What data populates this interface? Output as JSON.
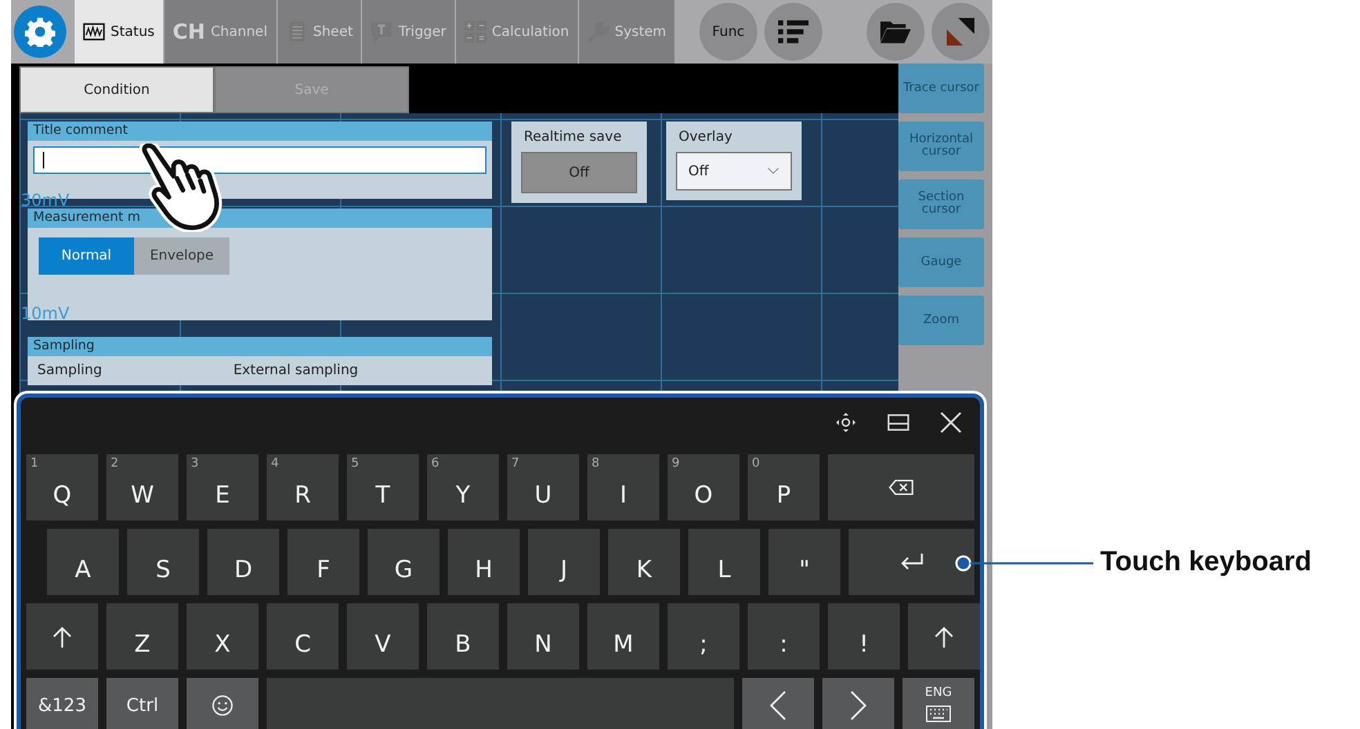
{
  "toolbar": {
    "tabs": [
      {
        "label": "Status",
        "selected": true
      },
      {
        "label": "Channel",
        "icon_text": "CH",
        "selected": false
      },
      {
        "label": "Sheet",
        "selected": false
      },
      {
        "label": "Trigger",
        "selected": false
      },
      {
        "label": "Calculation",
        "selected": false
      },
      {
        "label": "System",
        "selected": false
      }
    ],
    "func_button": "Func"
  },
  "sub_tabs": [
    {
      "label": "Condition",
      "selected": true
    },
    {
      "label": "Save",
      "selected": false
    }
  ],
  "axis_labels": [
    "30mV",
    "10mV"
  ],
  "title_comment": {
    "header": "Title comment"
  },
  "measurement_mode": {
    "header": "Measurement m",
    "options": [
      {
        "label": "Normal",
        "selected": true
      },
      {
        "label": "Envelope",
        "selected": false
      }
    ]
  },
  "sampling": {
    "header": "Sampling",
    "label": "Sampling",
    "value": "External sampling"
  },
  "realtime_save": {
    "header": "Realtime save",
    "value": "Off"
  },
  "overlay": {
    "header": "Overlay",
    "value": "Off"
  },
  "side_buttons": [
    "Trace cursor",
    "Horizontal cursor",
    "Section cursor",
    "Gauge",
    "Zoom"
  ],
  "keyboard": {
    "rows": [
      [
        {
          "kind": "char",
          "label": "Q",
          "hint": "1"
        },
        {
          "kind": "char",
          "label": "W",
          "hint": "2"
        },
        {
          "kind": "char",
          "label": "E",
          "hint": "3"
        },
        {
          "kind": "char",
          "label": "R",
          "hint": "4"
        },
        {
          "kind": "char",
          "label": "T",
          "hint": "5"
        },
        {
          "kind": "char",
          "label": "Y",
          "hint": "6"
        },
        {
          "kind": "char",
          "label": "U",
          "hint": "7"
        },
        {
          "kind": "char",
          "label": "I",
          "hint": "8"
        },
        {
          "kind": "char",
          "label": "O",
          "hint": "9"
        },
        {
          "kind": "char",
          "label": "P",
          "hint": "0"
        },
        {
          "kind": "backspace"
        }
      ],
      [
        {
          "kind": "char",
          "label": "A"
        },
        {
          "kind": "char",
          "label": "S"
        },
        {
          "kind": "char",
          "label": "D"
        },
        {
          "kind": "char",
          "label": "F"
        },
        {
          "kind": "char",
          "label": "G"
        },
        {
          "kind": "char",
          "label": "H"
        },
        {
          "kind": "char",
          "label": "J"
        },
        {
          "kind": "char",
          "label": "K"
        },
        {
          "kind": "char",
          "label": "L"
        },
        {
          "kind": "char",
          "label": "\""
        },
        {
          "kind": "enter"
        }
      ],
      [
        {
          "kind": "shift"
        },
        {
          "kind": "char",
          "label": "Z"
        },
        {
          "kind": "char",
          "label": "X"
        },
        {
          "kind": "char",
          "label": "C"
        },
        {
          "kind": "char",
          "label": "V"
        },
        {
          "kind": "char",
          "label": "B"
        },
        {
          "kind": "char",
          "label": "N"
        },
        {
          "kind": "char",
          "label": "M"
        },
        {
          "kind": "char",
          "label": ";"
        },
        {
          "kind": "char",
          "label": ":"
        },
        {
          "kind": "char",
          "label": "!"
        },
        {
          "kind": "shift"
        }
      ],
      [
        {
          "kind": "func",
          "label": "&123"
        },
        {
          "kind": "func",
          "label": "Ctrl"
        },
        {
          "kind": "emoji"
        },
        {
          "kind": "space"
        },
        {
          "kind": "left"
        },
        {
          "kind": "right"
        },
        {
          "kind": "lang",
          "label": "ENG"
        }
      ]
    ]
  },
  "callout": "Touch keyboard"
}
